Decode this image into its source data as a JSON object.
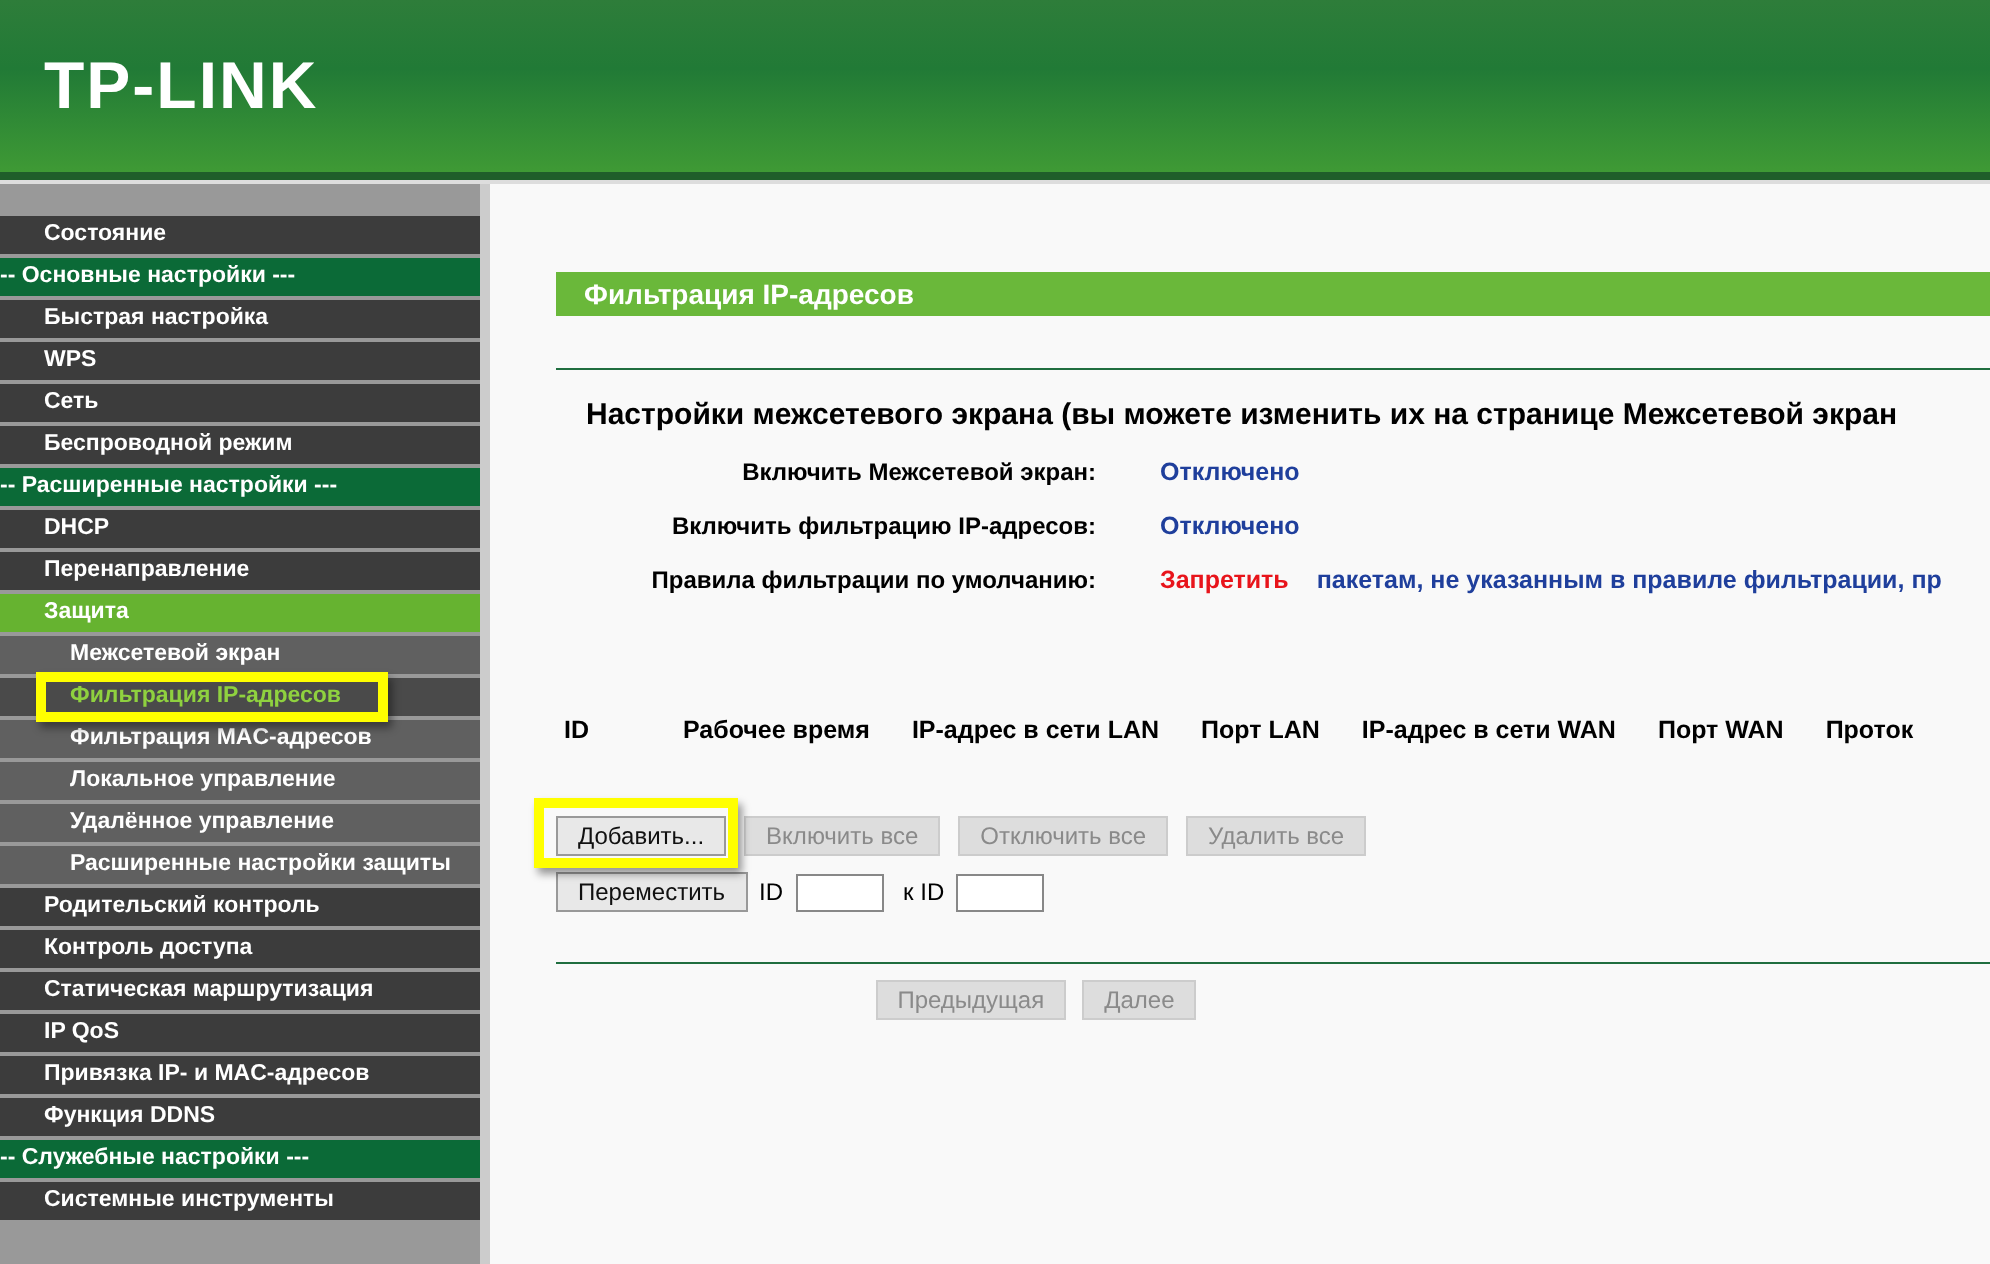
{
  "header": {
    "logo": "TP-LINK"
  },
  "sidebar": {
    "items": [
      {
        "label": "Состояние",
        "kind": "item",
        "selected": false
      },
      {
        "label": "-- Основные настройки ---",
        "kind": "section"
      },
      {
        "label": "Быстрая настройка",
        "kind": "item",
        "selected": false
      },
      {
        "label": "WPS",
        "kind": "item",
        "selected": false
      },
      {
        "label": "Сеть",
        "kind": "item",
        "selected": false
      },
      {
        "label": "Беспроводной режим",
        "kind": "item",
        "selected": false
      },
      {
        "label": "-- Расширенные настройки ---",
        "kind": "section"
      },
      {
        "label": "DHCP",
        "kind": "item",
        "selected": false
      },
      {
        "label": "Перенаправление",
        "kind": "item",
        "selected": false
      },
      {
        "label": "Защита",
        "kind": "item",
        "selected": true,
        "children": [
          {
            "label": "Межсетевой экран",
            "selected": false,
            "highlighted": false
          },
          {
            "label": "Фильтрация IP-адресов",
            "selected": true,
            "highlighted": true
          },
          {
            "label": "Фильтрация MAC-адресов",
            "selected": false,
            "highlighted": false
          },
          {
            "label": "Локальное управление",
            "selected": false,
            "highlighted": false
          },
          {
            "label": "Удалённое управление",
            "selected": false,
            "highlighted": false
          },
          {
            "label": "Расширенные настройки защиты",
            "selected": false,
            "highlighted": false
          }
        ]
      },
      {
        "label": "Родительский контроль",
        "kind": "item",
        "selected": false
      },
      {
        "label": "Контроль доступа",
        "kind": "item",
        "selected": false
      },
      {
        "label": "Статическая маршрутизация",
        "kind": "item",
        "selected": false
      },
      {
        "label": "IP QoS",
        "kind": "item",
        "selected": false
      },
      {
        "label": "Привязка IP- и MAC-адресов",
        "kind": "item",
        "selected": false
      },
      {
        "label": "Функция DDNS",
        "kind": "item",
        "selected": false
      },
      {
        "label": "-- Служебные настройки ---",
        "kind": "section"
      },
      {
        "label": "Системные инструменты",
        "kind": "item",
        "selected": false
      }
    ]
  },
  "content": {
    "title": "Фильтрация IP-адресов",
    "heading": "Настройки межсетевого экрана (вы можете изменить их на странице Межсетевой экран",
    "settings": [
      {
        "label": "Включить Межсетевой экран:",
        "value": "Отключено"
      },
      {
        "label": "Включить фильтрацию IP-адресов:",
        "value": "Отключено"
      },
      {
        "label": "Правила фильтрации по умолчанию:",
        "value": "Запретить",
        "note": "пакетам, не указанным в правиле фильтрации, пр"
      }
    ],
    "columns": [
      "ID",
      "Рабочее время",
      "IP-адрес в сети LAN",
      "Порт LAN",
      "IP-адрес в сети WAN",
      "Порт WAN",
      "Проток"
    ],
    "buttons": [
      {
        "label": "Добавить...",
        "disabled": false,
        "highlighted": true
      },
      {
        "label": "Включить все",
        "disabled": true,
        "highlighted": false
      },
      {
        "label": "Отключить все",
        "disabled": true,
        "highlighted": false
      },
      {
        "label": "Удалить все",
        "disabled": true,
        "highlighted": false
      }
    ],
    "move": {
      "button": "Переместить",
      "from_label": "ID",
      "to_label": "к ID"
    },
    "pager": [
      {
        "label": "Предыдущая",
        "disabled": true
      },
      {
        "label": "Далее",
        "disabled": true
      }
    ]
  }
}
